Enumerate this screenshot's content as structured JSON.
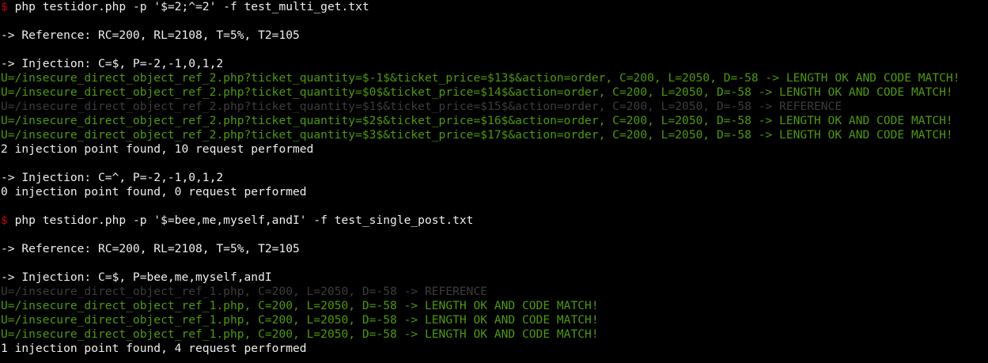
{
  "terminal": {
    "lines": [
      {
        "prompt": "$ ",
        "text": "php testidor.php -p '$=2;^=2' -f test_multi_get.txt",
        "kind": "command"
      },
      {
        "text": "",
        "kind": "blank"
      },
      {
        "text": "-> Reference: RC=200, RL=2108, T=5%, T2=105",
        "kind": "output"
      },
      {
        "text": "",
        "kind": "blank"
      },
      {
        "text": "-> Injection: C=$, P=-2,-1,0,1,2",
        "kind": "output"
      },
      {
        "text": "U=/insecure_direct_object_ref_2.php?ticket_quantity=$-1$&ticket_price=$13$&action=order, C=200, L=2050, D=-58 -> LENGTH OK AND CODE MATCH!",
        "kind": "match"
      },
      {
        "text": "U=/insecure_direct_object_ref_2.php?ticket_quantity=$0$&ticket_price=$14$&action=order, C=200, L=2050, D=-58 -> LENGTH OK AND CODE MATCH!",
        "kind": "match"
      },
      {
        "text": "U=/insecure_direct_object_ref_2.php?ticket_quantity=$1$&ticket_price=$15$&action=order, C=200, L=2050, D=-58 -> REFERENCE",
        "kind": "reference"
      },
      {
        "text": "U=/insecure_direct_object_ref_2.php?ticket_quantity=$2$&ticket_price=$16$&action=order, C=200, L=2050, D=-58 -> LENGTH OK AND CODE MATCH!",
        "kind": "match"
      },
      {
        "text": "U=/insecure_direct_object_ref_2.php?ticket_quantity=$3$&ticket_price=$17$&action=order, C=200, L=2050, D=-58 -> LENGTH OK AND CODE MATCH!",
        "kind": "match"
      },
      {
        "text": "2 injection point found, 10 request performed",
        "kind": "output"
      },
      {
        "text": "",
        "kind": "blank"
      },
      {
        "text": "-> Injection: C=^, P=-2,-1,0,1,2",
        "kind": "output"
      },
      {
        "text": "0 injection point found, 0 request performed",
        "kind": "output"
      },
      {
        "text": "",
        "kind": "blank"
      },
      {
        "prompt": "$ ",
        "text": "php testidor.php -p '$=bee,me,myself,andI' -f test_single_post.txt",
        "kind": "command"
      },
      {
        "text": "",
        "kind": "blank"
      },
      {
        "text": "-> Reference: RC=200, RL=2108, T=5%, T2=105",
        "kind": "output"
      },
      {
        "text": "",
        "kind": "blank"
      },
      {
        "text": "-> Injection: C=$, P=bee,me,myself,andI",
        "kind": "output"
      },
      {
        "text": "U=/insecure_direct_object_ref_1.php, C=200, L=2050, D=-58 -> REFERENCE",
        "kind": "reference"
      },
      {
        "text": "U=/insecure_direct_object_ref_1.php, C=200, L=2050, D=-58 -> LENGTH OK AND CODE MATCH!",
        "kind": "match"
      },
      {
        "text": "U=/insecure_direct_object_ref_1.php, C=200, L=2050, D=-58 -> LENGTH OK AND CODE MATCH!",
        "kind": "match"
      },
      {
        "text": "U=/insecure_direct_object_ref_1.php, C=200, L=2050, D=-58 -> LENGTH OK AND CODE MATCH!",
        "kind": "match"
      },
      {
        "text": "1 injection point found, 4 request performed",
        "kind": "output"
      }
    ]
  },
  "colors": {
    "background": "#000000",
    "text": "#eeeeec",
    "prompt": "#cc0000",
    "match": "#4e9a06",
    "reference": "#3c3c3c"
  }
}
